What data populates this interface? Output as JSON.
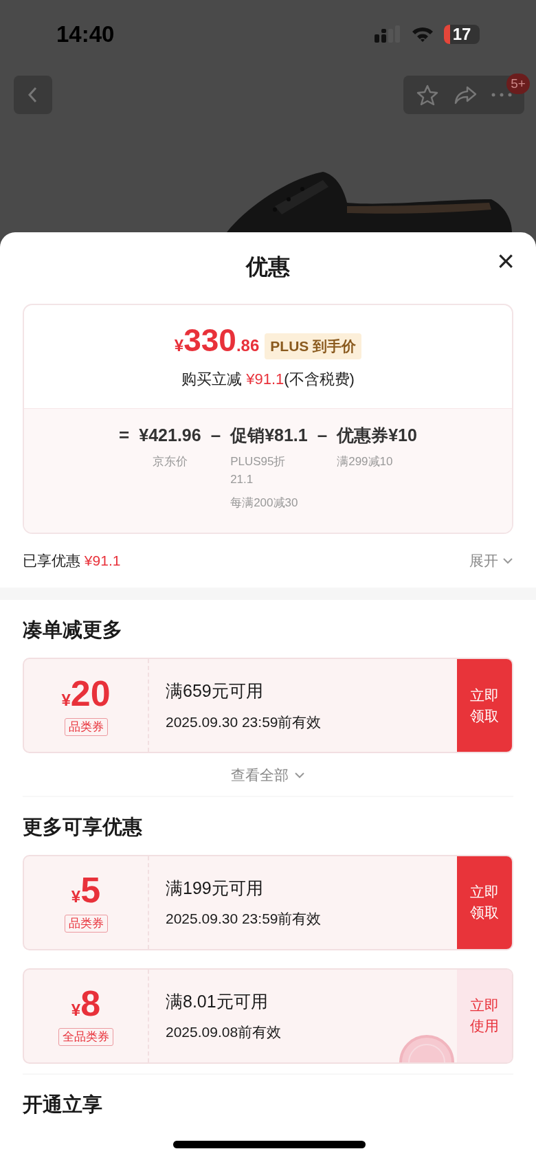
{
  "status_bar": {
    "time": "14:40",
    "battery": "17"
  },
  "nav": {
    "badge": "5+"
  },
  "sheet": {
    "title": "优惠",
    "close": "×"
  },
  "price_card": {
    "price": {
      "currency": "¥",
      "integer": "330",
      "decimal": ".86"
    },
    "price_tag": "PLUS 到手价",
    "discount": {
      "label": "购买立减 ",
      "amount": "¥91.1",
      "note": "(不含税费)"
    },
    "terms": [
      {
        "op": "=",
        "value": "¥421.96",
        "notes": [
          "京东价"
        ]
      },
      {
        "op": "–",
        "value": "促销¥81.1",
        "notes": [
          "PLUS95折21.1",
          "每满200减30"
        ]
      },
      {
        "op": "–",
        "value": "优惠券¥10",
        "notes": [
          "满299减10"
        ]
      }
    ]
  },
  "enjoyed": {
    "label": "已享优惠",
    "amount": "¥91.1",
    "toggle": "展开"
  },
  "sections": [
    {
      "title": "凑单减更多",
      "coupons": [
        {
          "currency": "¥",
          "amount": "20",
          "type": "品类券",
          "condition": "满659元可用",
          "validity": "2025.09.30 23:59前有效",
          "kind": "claim",
          "action": "立即领取",
          "claimed": false
        }
      ],
      "more": "查看全部"
    },
    {
      "title": "更多可享优惠",
      "coupons": [
        {
          "currency": "¥",
          "amount": "5",
          "type": "品类券",
          "condition": "满199元可用",
          "validity": "2025.09.30 23:59前有效",
          "kind": "claim",
          "action": "立即领取",
          "claimed": false
        },
        {
          "currency": "¥",
          "amount": "8",
          "type": "全品类券",
          "condition": "满8.01元可用",
          "validity": "2025.09.08前有效",
          "kind": "use",
          "action": "立即使用",
          "claimed": true
        }
      ]
    },
    {
      "title": "开通立享"
    }
  ]
}
